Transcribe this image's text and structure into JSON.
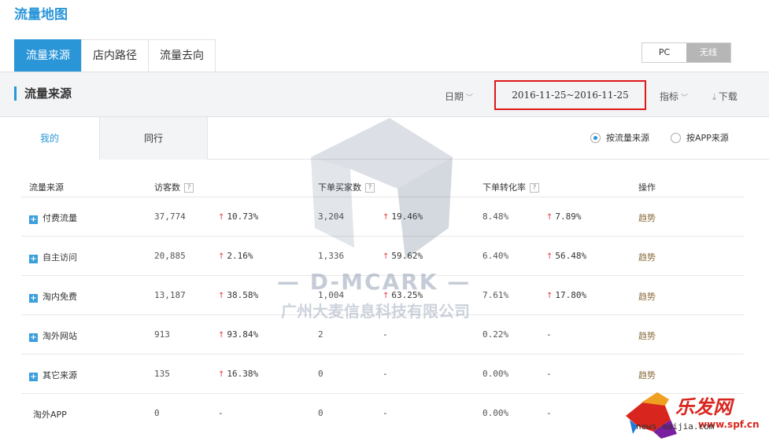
{
  "page": {
    "title": "流量地图"
  },
  "main_tabs": [
    {
      "label": "流量来源",
      "active": true
    },
    {
      "label": "店内路径",
      "active": false
    },
    {
      "label": "流量去向",
      "active": false
    }
  ],
  "device_toggle": [
    {
      "label": "PC",
      "active": false
    },
    {
      "label": "无线",
      "active": true
    }
  ],
  "section": {
    "title": "流量来源",
    "date_label": "日期",
    "date_range": "2016-11-25~2016-11-25",
    "metric_label": "指标",
    "download_label": "下载"
  },
  "sub_tabs": [
    {
      "label": "我的",
      "active": true
    },
    {
      "label": "同行",
      "active": false
    }
  ],
  "source_mode": [
    {
      "label": "按流量来源",
      "checked": true
    },
    {
      "label": "按APP来源",
      "checked": false
    }
  ],
  "table": {
    "headers": {
      "source": "流量来源",
      "visitors": "访客数",
      "buyers": "下单买家数",
      "conversion": "下单转化率",
      "action": "操作"
    },
    "help_mark": "?",
    "rows": [
      {
        "source": "付费流量",
        "expandable": true,
        "visitors": "37,774",
        "visitors_change": "10.73%",
        "buyers": "3,204",
        "buyers_change": "19.46%",
        "conversion": "8.48%",
        "conversion_change": "7.89%",
        "action": "趋势"
      },
      {
        "source": "自主访问",
        "expandable": true,
        "visitors": "20,885",
        "visitors_change": "2.16%",
        "buyers": "1,336",
        "buyers_change": "59.62%",
        "conversion": "6.40%",
        "conversion_change": "56.48%",
        "action": "趋势"
      },
      {
        "source": "淘内免费",
        "expandable": true,
        "visitors": "13,187",
        "visitors_change": "38.58%",
        "buyers": "1,004",
        "buyers_change": "63.25%",
        "conversion": "7.61%",
        "conversion_change": "17.80%",
        "action": "趋势"
      },
      {
        "source": "淘外网站",
        "expandable": true,
        "visitors": "913",
        "visitors_change": "93.84%",
        "buyers": "2",
        "buyers_change": "-",
        "conversion": "0.22%",
        "conversion_change": "-",
        "action": "趋势"
      },
      {
        "source": "其它来源",
        "expandable": true,
        "visitors": "135",
        "visitors_change": "16.38%",
        "buyers": "0",
        "buyers_change": "-",
        "conversion": "0.00%",
        "conversion_change": "-",
        "action": "趋势"
      },
      {
        "source": "淘外APP",
        "expandable": false,
        "visitors": "0",
        "visitors_change": "-",
        "buyers": "0",
        "buyers_change": "-",
        "conversion": "0.00%",
        "conversion_change": "-",
        "action": ""
      }
    ]
  },
  "watermark": {
    "brand": "— D-MCARK —",
    "company": "广州大麦信息科技有限公司"
  },
  "corner_logo": {
    "brand": "乐发网",
    "site": "www.spf.cn",
    "url": "news.maijia.com"
  },
  "colors": {
    "accent": "#2a96d8",
    "up_arrow": "#e23a3a",
    "highlight_border": "#e01818"
  }
}
